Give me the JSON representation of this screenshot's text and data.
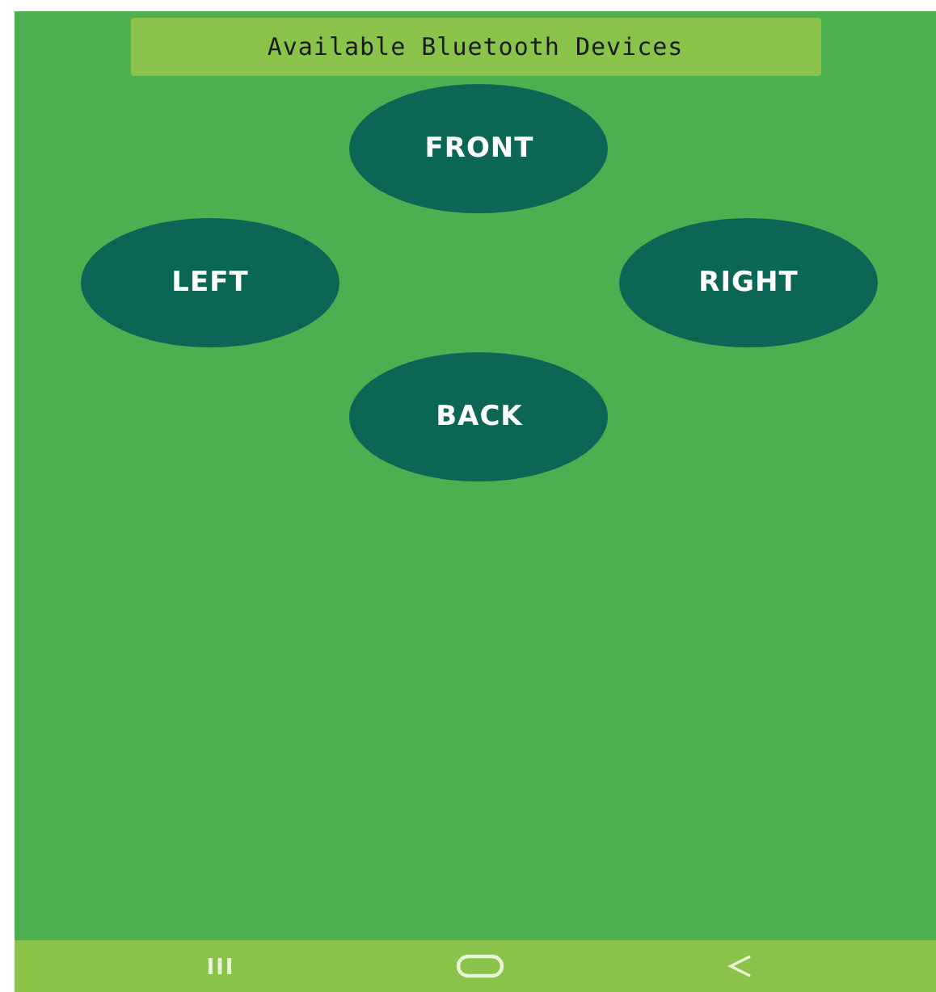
{
  "header": {
    "title": "Available Bluetooth Devices"
  },
  "buttons": [
    {
      "label": "FRONT"
    },
    {
      "label": "LEFT"
    },
    {
      "label": "RIGHT"
    },
    {
      "label": "BACK"
    }
  ]
}
